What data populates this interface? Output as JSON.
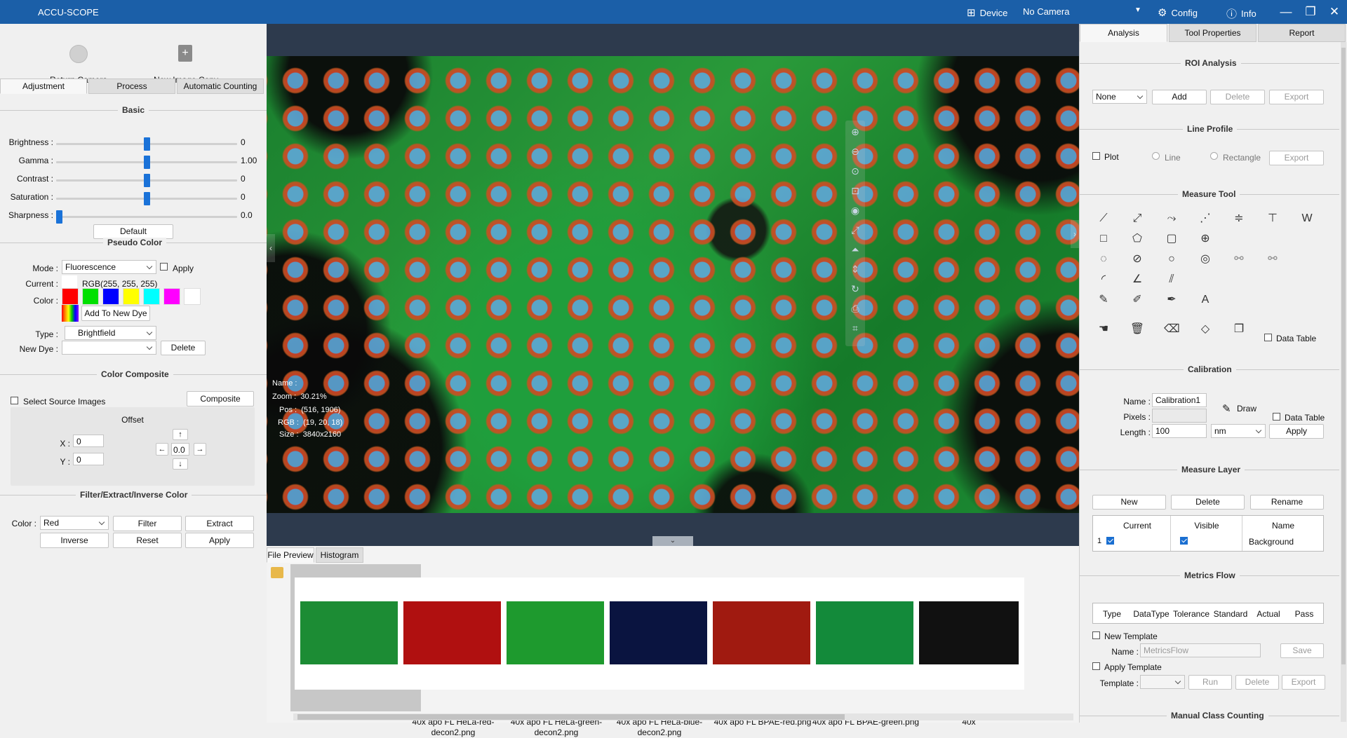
{
  "app": {
    "title": "ACCU-SCOPE"
  },
  "titlebar": {
    "device": "Device",
    "camera": "No Camera",
    "config": "Config",
    "info": "Info"
  },
  "left": {
    "top_buttons": {
      "return_camera": "Return Camera",
      "new_image_copy": "New Image Copy"
    },
    "tabs": [
      "Adjustment",
      "Process",
      "Automatic Counting"
    ],
    "basic": {
      "title": "Basic",
      "brightness": {
        "label": "Brightness :",
        "value": "0",
        "fraction": 0.5
      },
      "gamma": {
        "label": "Gamma :",
        "value": "1.00",
        "fraction": 0.5
      },
      "contrast": {
        "label": "Contrast :",
        "value": "0",
        "fraction": 0.5
      },
      "saturation": {
        "label": "Saturation :",
        "value": "0",
        "fraction": 0.5
      },
      "sharpness": {
        "label": "Sharpness :",
        "value": "0.0",
        "fraction": 0.0
      },
      "default_button": "Default"
    },
    "pseudo": {
      "title": "Pseudo Color",
      "mode_label": "Mode :",
      "mode_value": "Fluorescence",
      "apply_label": "Apply",
      "current_label": "Current :",
      "current_value": "RGB(255, 255, 255)",
      "color_label": "Color :",
      "colors": [
        "#ff0000",
        "#00e000",
        "#0000ff",
        "#ffff00",
        "#00ffff",
        "#ff00ff",
        "#ffffff"
      ],
      "add_dye": "Add To New Dye",
      "type_label": "Type :",
      "type_value": "Brightfield",
      "newdye_label": "New Dye :",
      "newdye_value": "",
      "delete_button": "Delete"
    },
    "composite": {
      "title": "Color Composite",
      "select_source": "Select Source Images",
      "composite_button": "Composite",
      "offset_title": "Offset",
      "x_label": "X :",
      "x_value": "0",
      "y_label": "Y :",
      "y_value": "0",
      "center_value": "0.0"
    },
    "filter": {
      "title": "Filter/Extract/Inverse Color",
      "color_label": "Color :",
      "color_value": "Red",
      "filter_button": "Filter",
      "extract_button": "Extract",
      "inverse_button": "Inverse",
      "reset_button": "Reset",
      "apply_button": "Apply"
    }
  },
  "viewer": {
    "name_label": "Name :",
    "name_value": "",
    "zoom_label": "Zoom :",
    "zoom_value": "30.21%",
    "pos_label": "Pos :",
    "pos_value": "(516, 1906)",
    "rgb_label": "RGB :",
    "rgb_value": "(19, 20, 18)",
    "size_label": "Size :",
    "size_value": "3840x2160"
  },
  "bottom": {
    "tabs": [
      "File Preview",
      "Histogram"
    ],
    "files": [
      {
        "label": "",
        "color": "#1c8c34"
      },
      {
        "label": "40x apo FL HeLa-red-decon2.png",
        "color": "#b01010"
      },
      {
        "label": "40x apo FL HeLa-green-decon2.png",
        "color": "#1e9a2e"
      },
      {
        "label": "40x apo FL HeLa-blue-decon2.png",
        "color": "#0a1440"
      },
      {
        "label": "40x apo FL BPAE-red.png",
        "color": "#a01a10"
      },
      {
        "label": "40x apo FL BPAE-green.png",
        "color": "#138a3a"
      },
      {
        "label": "40x",
        "color": "#111111"
      }
    ]
  },
  "right": {
    "tabs": [
      "Analysis",
      "Tool Properties",
      "Report"
    ],
    "roi": {
      "title": "ROI Analysis",
      "select_value": "None",
      "add": "Add",
      "delete": "Delete",
      "export": "Export"
    },
    "line_profile": {
      "title": "Line Profile",
      "plot": "Plot",
      "line": "Line",
      "rectangle": "Rectangle",
      "export": "Export"
    },
    "measure_tool": {
      "title": "Measure Tool",
      "data_table": "Data Table",
      "text_tool": "A"
    },
    "calibration": {
      "title": "Calibration",
      "name_label": "Name :",
      "name_value": "Calibration1",
      "draw": "Draw",
      "data_table": "Data Table",
      "pixels_label": "Pixels :",
      "length_label": "Length :",
      "length_value": "100",
      "unit_value": "nm",
      "apply": "Apply"
    },
    "measure_layer": {
      "title": "Measure Layer",
      "new": "New",
      "delete": "Delete",
      "rename": "Rename",
      "columns": [
        "Current",
        "Visible",
        "Name"
      ],
      "rows": [
        {
          "index": "1",
          "name": "Background"
        }
      ]
    },
    "metrics_flow": {
      "title": "Metrics Flow",
      "columns": [
        "Type",
        "DataType",
        "Tolerance",
        "Standard",
        "Actual",
        "Pass"
      ],
      "new_template": "New Template",
      "name_label": "Name :",
      "name_placeholder": "MetricsFlow",
      "save": "Save",
      "apply_template": "Apply Template",
      "template_label": "Template :",
      "run": "Run",
      "delete": "Delete",
      "export": "Export"
    },
    "manual_class": {
      "title": "Manual Class Counting"
    }
  }
}
